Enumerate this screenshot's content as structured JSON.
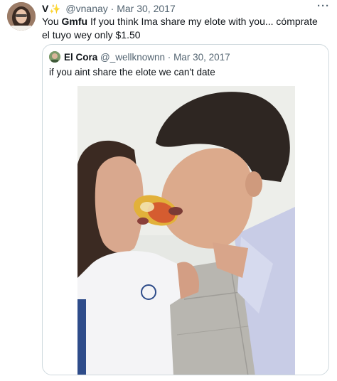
{
  "tweet": {
    "display_name": "V",
    "sparkle": "✨",
    "handle": "@vnanay",
    "separator": "·",
    "date": "Mar 30, 2017",
    "more": "···",
    "text_before": "You ",
    "text_mention": "Gmfu",
    "text_after": " If you think Ima share my elote with you... cómprate el tuyo wey only $1.50"
  },
  "quoted_tweet": {
    "display_name": "El Cora",
    "handle": "@_wellknownn",
    "separator": "·",
    "date": "Mar 30, 2017",
    "text": "if you aint share the elote we can't date"
  }
}
